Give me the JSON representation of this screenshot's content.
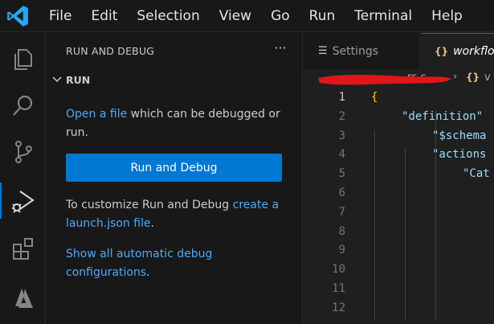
{
  "menu": [
    "File",
    "Edit",
    "Selection",
    "View",
    "Go",
    "Run",
    "Terminal",
    "Help"
  ],
  "activity_bar": [
    {
      "icon": "explorer-icon"
    },
    {
      "icon": "search-icon"
    },
    {
      "icon": "source-control-icon"
    },
    {
      "icon": "run-and-debug-icon",
      "active": true
    },
    {
      "icon": "extensions-icon"
    },
    {
      "icon": "azure-icon"
    }
  ],
  "sidebar": {
    "title": "RUN AND DEBUG",
    "more": "···",
    "section": "RUN",
    "open_link": "Open a file",
    "open_rest": " which can be debugged or run.",
    "button": "Run and Debug",
    "customize_text": "To customize Run and Debug ",
    "customize_link": "create a launch.json file",
    "customize_end": ".",
    "show_link": "Show all automatic debug configurations",
    "show_end": "."
  },
  "editor": {
    "tabs": [
      {
        "label": "Settings",
        "icon": "settings-lines-icon"
      },
      {
        "label": "workflo",
        "icon": "json-braces-icon",
        "active": true
      }
    ],
    "breadcrumb": {
      "text": "rs  c",
      "sep": "›",
      "json": "{}",
      "tail": "v"
    },
    "line_numbers": [
      "1",
      "2",
      "3",
      "4",
      "5",
      "6",
      "7",
      "8",
      "9",
      "10",
      "11",
      "12"
    ],
    "current_line": "1",
    "code": [
      {
        "text": "{",
        "cls": "brace",
        "indent": 0
      },
      {
        "text": "\"definition\"",
        "cls": "key",
        "indent": 1
      },
      {
        "text": "\"$schema",
        "cls": "key",
        "indent": 2
      },
      {
        "text": "\"actions",
        "cls": "key",
        "indent": 2
      },
      {
        "text": "\"Cat",
        "cls": "key",
        "indent": 3
      }
    ]
  },
  "colors": {
    "accent": "#0078d4",
    "link": "#4daafc",
    "redaction": "#e0161b"
  }
}
